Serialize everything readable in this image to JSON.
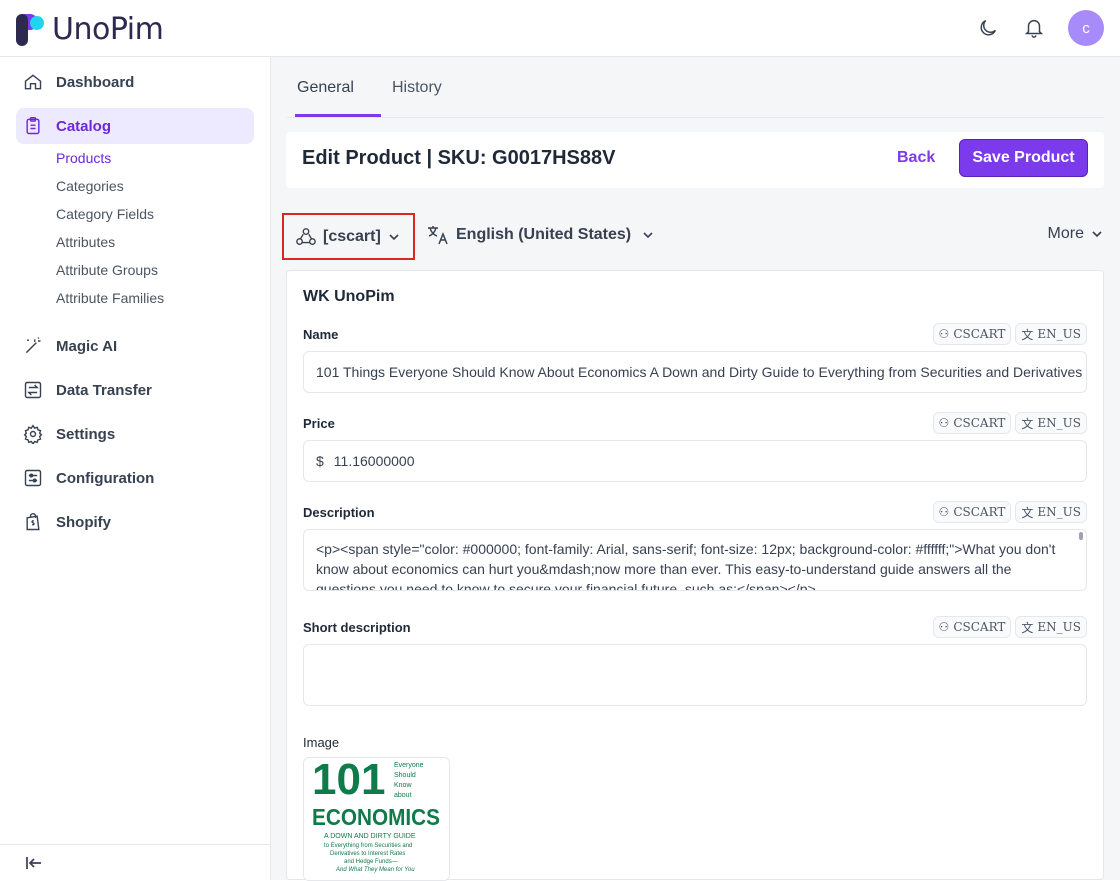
{
  "app": {
    "logo_text": "UnoPim",
    "avatar_letter": "c"
  },
  "sidebar": {
    "items": [
      {
        "label": "Dashboard"
      },
      {
        "label": "Catalog"
      },
      {
        "label": "Magic AI"
      },
      {
        "label": "Data Transfer"
      },
      {
        "label": "Settings"
      },
      {
        "label": "Configuration"
      },
      {
        "label": "Shopify"
      }
    ],
    "catalog_sub": [
      "Products",
      "Categories",
      "Category Fields",
      "Attributes",
      "Attribute Groups",
      "Attribute Families"
    ]
  },
  "tabs": [
    "General",
    "History"
  ],
  "header": {
    "title": "Edit Product | SKU: G0017HS88V",
    "back_label": "Back",
    "save_label": "Save Product"
  },
  "selectors": {
    "channel": "[cscart]",
    "locale": "English (United States)",
    "more": "More"
  },
  "form": {
    "section_title": "WK UnoPim",
    "badge_channel": "CSCART",
    "badge_locale": "EN_US",
    "name_label": "Name",
    "name_value": "101 Things Everyone Should Know About Economics A Down and Dirty Guide to Everything from Securities and Derivatives",
    "price_label": "Price",
    "price_currency": "$",
    "price_value": "11.16000000",
    "description_label": "Description",
    "description_value": "<p><span style=\"color: #000000; font-family: Arial, sans-serif; font-size: 12px; background-color: #ffffff;\">What you don't know about economics can hurt you&mdash;now more than ever. This easy-to-understand guide answers all the questions you need to know to secure your financial future, such as:</span></p>",
    "short_description_label": "Short description",
    "short_description_value": "",
    "image_label": "Image"
  },
  "image": {
    "number": "101",
    "top_words": [
      "Everyone",
      "Should",
      "Know",
      "about"
    ],
    "title": "ECONOMICS",
    "subtitle": "A DOWN AND DIRTY GUIDE",
    "lines": [
      "to Everything from Securities and",
      "Derivatives to Interest Rates",
      "and Hedge Funds—",
      "And What They Mean for You"
    ]
  },
  "colors": {
    "accent": "#7c3aed",
    "highlight_border": "#dc2626",
    "book_green": "#0f7a4a"
  }
}
